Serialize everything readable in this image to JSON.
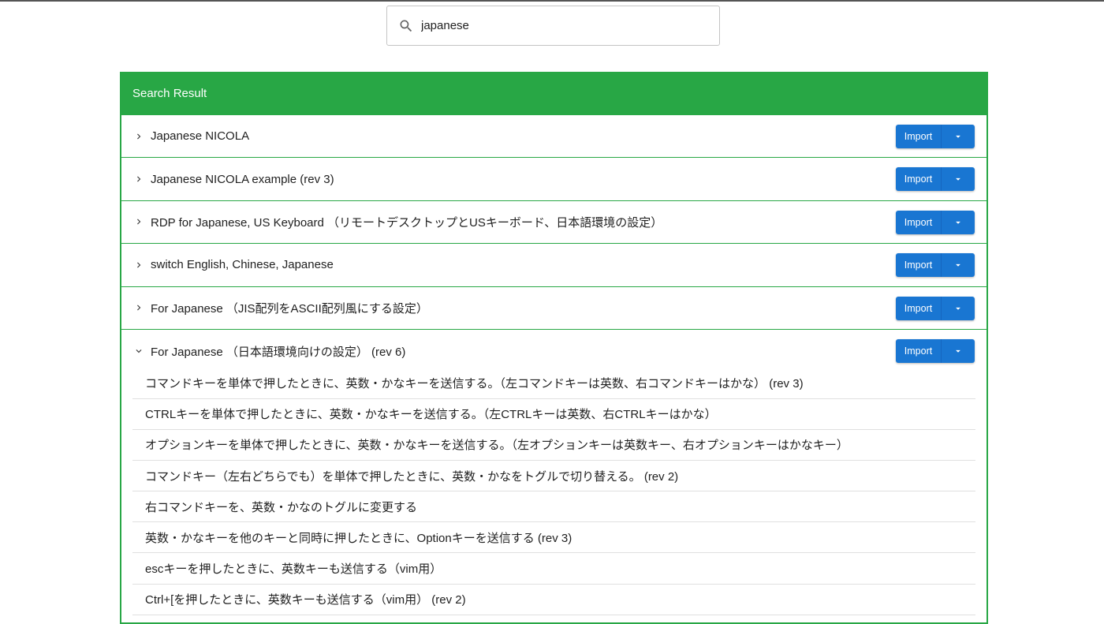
{
  "search": {
    "value": "japanese",
    "icon": "search-icon"
  },
  "panel": {
    "header": "Search Result",
    "accent": "#28a745",
    "button_color": "#1976d2"
  },
  "results": [
    {
      "title": "Japanese NICOLA",
      "expanded": false,
      "import_label": "Import"
    },
    {
      "title": "Japanese NICOLA example (rev 3)",
      "expanded": false,
      "import_label": "Import"
    },
    {
      "title": "RDP for Japanese, US Keyboard （リモートデスクトップとUSキーボード、日本語環境の設定）",
      "expanded": false,
      "import_label": "Import"
    },
    {
      "title": "switch English, Chinese, Japanese",
      "expanded": false,
      "import_label": "Import"
    },
    {
      "title": "For Japanese （JIS配列をASCII配列風にする設定）",
      "expanded": false,
      "import_label": "Import"
    },
    {
      "title": "For Japanese （日本語環境向けの設定） (rev 6)",
      "expanded": true,
      "import_label": "Import"
    }
  ],
  "sub_items": [
    "コマンドキーを単体で押したときに、英数・かなキーを送信する。（左コマンドキーは英数、右コマンドキーはかな） (rev 3)",
    "CTRLキーを単体で押したときに、英数・かなキーを送信する。（左CTRLキーは英数、右CTRLキーはかな）",
    "オプションキーを単体で押したときに、英数・かなキーを送信する。（左オプションキーは英数キー、右オプションキーはかなキー）",
    "コマンドキー（左右どちらでも）を単体で押したときに、英数・かなをトグルで切り替える。 (rev 2)",
    "右コマンドキーを、英数・かなのトグルに変更する",
    "英数・かなキーを他のキーと同時に押したときに、Optionキーを送信する (rev 3)",
    "escキーを押したときに、英数キーも送信する（vim用）",
    "Ctrl+[を押したときに、英数キーも送信する（vim用） (rev 2)"
  ]
}
